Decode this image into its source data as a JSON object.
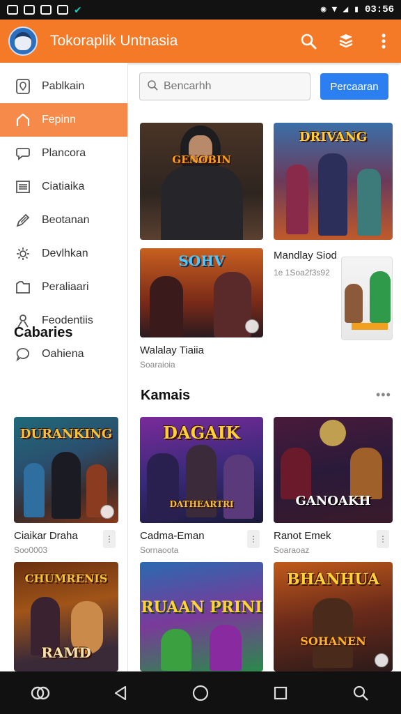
{
  "app": {
    "title": "Tokoraplik Untnasia"
  },
  "statusbar": {
    "time": "03:56"
  },
  "sidebar": {
    "items": [
      {
        "label": "Pablkain",
        "icon": "map-pin-icon"
      },
      {
        "label": "Fepinn",
        "icon": "home-icon"
      },
      {
        "label": "Plancora",
        "icon": "chat-icon"
      },
      {
        "label": "Ciatiaika",
        "icon": "list-icon"
      },
      {
        "label": "Beotanan",
        "icon": "pen-icon"
      },
      {
        "label": "Devlhkan",
        "icon": "settings-icon"
      },
      {
        "label": "Peraliaari",
        "icon": "folder-icon"
      },
      {
        "label": "Feodentiis",
        "icon": "person-icon"
      },
      {
        "label": "Oahiena",
        "icon": "comment-icon"
      }
    ],
    "section_heading": "Cabaries",
    "cards": [
      {
        "title": "Ciaikar Draha",
        "subtitle": "Soo0003",
        "art_text": "DURANKING"
      },
      {
        "title": "",
        "subtitle": "",
        "art_text": "CHUMRENIS",
        "art_text2": "RAMD"
      }
    ]
  },
  "search": {
    "placeholder": "Bencarhh",
    "button_label": "Percaaran"
  },
  "featured": [
    {
      "title": "",
      "subtitle": "",
      "art_text": "GENOBIN"
    },
    {
      "title": "",
      "subtitle": "",
      "art_text": "DRIVANG"
    },
    {
      "title": "Walalay Tiaiia",
      "subtitle": "Soaraioia",
      "art_text": "SOHV"
    },
    {
      "title": "Mandlay Siod",
      "subtitle": "1e 1Soa2f3s92"
    }
  ],
  "section": {
    "heading": "Kamais",
    "more_label": "•••",
    "cards": [
      {
        "title": "Cadma-Eman",
        "subtitle": "Sornaoota",
        "art_text": "DAGAIK",
        "art_text2": "DATHEARTRI"
      },
      {
        "title": "Ranot Emek",
        "subtitle": "Soaraoaz",
        "art_text": "GANOAKH"
      },
      {
        "title": "",
        "subtitle": "",
        "art_text": "RUAAN PRINI"
      },
      {
        "title": "",
        "subtitle": "",
        "art_text": "BHANHUA",
        "art_text2": "SOHANEN"
      }
    ]
  },
  "colors": {
    "accent": "#f57a27",
    "active_nav": "#f58a4a",
    "button": "#2c7ff0"
  }
}
